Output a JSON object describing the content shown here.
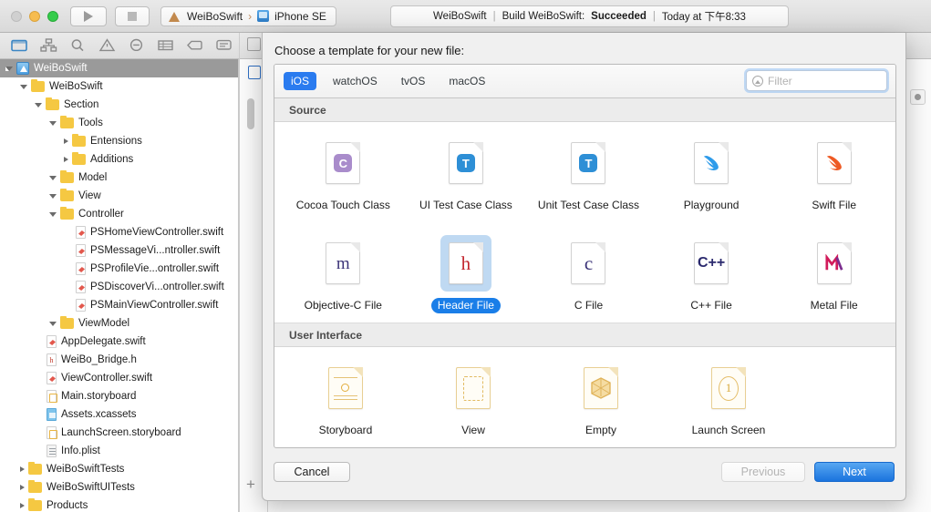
{
  "titlebar": {
    "run_icon": "play-icon",
    "stop_icon": "stop-icon",
    "scheme_name": "WeiBoSwift",
    "scheme_separator": "›",
    "destination": "iPhone SE",
    "status": {
      "project": "WeiBoSwift",
      "sep": "|",
      "action": "Build WeiBoSwift:",
      "result": "Succeeded",
      "time": "Today at 下午8:33"
    }
  },
  "navigator": {
    "toolbar_icons": [
      "folder-icon",
      "hierarchy-icon",
      "search-icon",
      "warning-icon",
      "issue-icon",
      "test-icon",
      "tag-icon",
      "report-icon"
    ],
    "tree": [
      {
        "label": "WeiBoSwift",
        "icon": "project-icon",
        "depth": 0,
        "twisty": "open",
        "selected": true
      },
      {
        "label": "WeiBoSwift",
        "icon": "folder-icon",
        "depth": 1,
        "twisty": "open"
      },
      {
        "label": "Section",
        "icon": "folder-icon",
        "depth": 2,
        "twisty": "open"
      },
      {
        "label": "Tools",
        "icon": "folder-icon",
        "depth": 3,
        "twisty": "open"
      },
      {
        "label": "Entensions",
        "icon": "folder-icon",
        "depth": 4,
        "twisty": "closed"
      },
      {
        "label": "Additions",
        "icon": "folder-icon",
        "depth": 4,
        "twisty": "closed"
      },
      {
        "label": "Model",
        "icon": "folder-icon",
        "depth": 3,
        "twisty": "open"
      },
      {
        "label": "View",
        "icon": "folder-icon",
        "depth": 3,
        "twisty": "open"
      },
      {
        "label": "Controller",
        "icon": "folder-icon",
        "depth": 3,
        "twisty": "open"
      },
      {
        "label": "PSHomeViewController.swift",
        "icon": "swift-file-icon",
        "depth": 4,
        "twisty": "none"
      },
      {
        "label": "PSMessageVi...ntroller.swift",
        "icon": "swift-file-icon",
        "depth": 4,
        "twisty": "none"
      },
      {
        "label": "PSProfileVie...ontroller.swift",
        "icon": "swift-file-icon",
        "depth": 4,
        "twisty": "none"
      },
      {
        "label": "PSDiscoverVi...ontroller.swift",
        "icon": "swift-file-icon",
        "depth": 4,
        "twisty": "none"
      },
      {
        "label": "PSMainViewController.swift",
        "icon": "swift-file-icon",
        "depth": 4,
        "twisty": "none"
      },
      {
        "label": "ViewModel",
        "icon": "folder-icon",
        "depth": 3,
        "twisty": "open"
      },
      {
        "label": "AppDelegate.swift",
        "icon": "swift-file-icon",
        "depth": 2,
        "twisty": "none"
      },
      {
        "label": "WeiBo_Bridge.h",
        "icon": "header-file-icon",
        "depth": 2,
        "twisty": "none"
      },
      {
        "label": "ViewController.swift",
        "icon": "swift-file-icon",
        "depth": 2,
        "twisty": "none"
      },
      {
        "label": "Main.storyboard",
        "icon": "storyboard-file-icon",
        "depth": 2,
        "twisty": "none"
      },
      {
        "label": "Assets.xcassets",
        "icon": "assets-catalog-icon",
        "depth": 2,
        "twisty": "none"
      },
      {
        "label": "LaunchScreen.storyboard",
        "icon": "storyboard-file-icon",
        "depth": 2,
        "twisty": "none"
      },
      {
        "label": "Info.plist",
        "icon": "plist-file-icon",
        "depth": 2,
        "twisty": "none"
      },
      {
        "label": "WeiBoSwiftTests",
        "icon": "folder-icon",
        "depth": 1,
        "twisty": "closed"
      },
      {
        "label": "WeiBoSwiftUITests",
        "icon": "folder-icon",
        "depth": 1,
        "twisty": "closed"
      },
      {
        "label": "Products",
        "icon": "folder-icon",
        "depth": 1,
        "twisty": "closed"
      }
    ],
    "add_button": "+"
  },
  "sheet": {
    "title": "Choose a template for your new file:",
    "platform_tabs": [
      {
        "label": "iOS",
        "active": true
      },
      {
        "label": "watchOS",
        "active": false
      },
      {
        "label": "tvOS",
        "active": false
      },
      {
        "label": "macOS",
        "active": false
      }
    ],
    "filter": {
      "placeholder": "Filter",
      "value": "",
      "icon": "filter-icon"
    },
    "sections": [
      {
        "header": "Source",
        "items": [
          {
            "label": "Cocoa Touch Class",
            "icon": "cocoa-touch-class-icon",
            "selected": false
          },
          {
            "label": "UI Test Case Class",
            "icon": "ui-test-case-class-icon",
            "selected": false
          },
          {
            "label": "Unit Test Case Class",
            "icon": "unit-test-case-class-icon",
            "selected": false
          },
          {
            "label": "Playground",
            "icon": "playground-icon",
            "selected": false
          },
          {
            "label": "Swift File",
            "icon": "swift-file-icon",
            "selected": false
          },
          {
            "label": "Objective-C File",
            "icon": "objective-c-file-icon",
            "selected": false
          },
          {
            "label": "Header File",
            "icon": "header-file-icon",
            "selected": true
          },
          {
            "label": "C File",
            "icon": "c-file-icon",
            "selected": false
          },
          {
            "label": "C++ File",
            "icon": "cpp-file-icon",
            "selected": false
          },
          {
            "label": "Metal File",
            "icon": "metal-file-icon",
            "selected": false
          }
        ]
      },
      {
        "header": "User Interface",
        "items": [
          {
            "label": "Storyboard",
            "icon": "storyboard-icon",
            "selected": false
          },
          {
            "label": "View",
            "icon": "view-icon",
            "selected": false
          },
          {
            "label": "Empty",
            "icon": "empty-icon",
            "selected": false
          },
          {
            "label": "Launch Screen",
            "icon": "launch-screen-icon",
            "selected": false
          }
        ]
      }
    ],
    "buttons": {
      "cancel": "Cancel",
      "previous": "Previous",
      "next": "Next"
    }
  },
  "colors": {
    "accent_blue": "#2a7bef",
    "selection_fill": "#bfd9f2",
    "selection_pill": "#1a7ee8",
    "folder_yellow": "#f5c842",
    "swift_orange": "#e2574c"
  }
}
